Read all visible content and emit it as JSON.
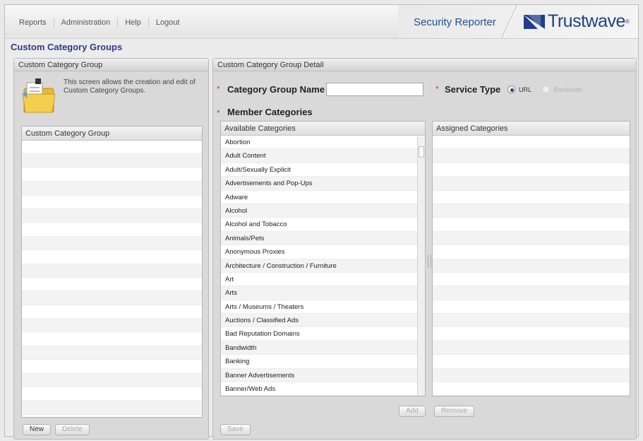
{
  "nav": {
    "items": [
      "Reports",
      "Administration",
      "Help",
      "Logout"
    ]
  },
  "brand": {
    "product": "Security Reporter",
    "logo": "Trustwave",
    "logo_reg": "®",
    "logo_icon": "trustwave-logo-icon"
  },
  "page_title": "Custom Category Groups",
  "left_panel": {
    "title": "Custom Category Group",
    "info_text": "This screen allows the creation and edit of Custom Category Groups.",
    "info_icon": "folder-icon",
    "grid_header": "Custom Category Group",
    "rows": [
      "",
      "",
      "",
      "",
      "",
      "",
      "",
      "",
      "",
      "",
      "",
      "",
      "",
      "",
      "",
      "",
      "",
      "",
      "",
      ""
    ],
    "new_label": "New",
    "delete_label": "Delete"
  },
  "right_panel": {
    "title": "Custom Category Group Detail",
    "required_mark": "*",
    "name_label": "Category Group Name",
    "name_value": "",
    "service_type_label": "Service Type",
    "service_options": [
      {
        "label": "URL",
        "selected": true,
        "enabled": true
      },
      {
        "label": "Bandwidth",
        "selected": false,
        "enabled": false
      }
    ],
    "member_label": "Member Categories",
    "available_header": "Available Categories",
    "available": [
      "Abortion",
      "Adult Content",
      "Adult/Sexually Explicit",
      "Advertisements and Pop-Ups",
      "Adware",
      "Alcohol",
      "Alcohol and Tobacco",
      "Animals/Pets",
      "Anonymous Proxies",
      "Architecture / Construction / Furniture",
      "Art",
      "Arts",
      "Arts / Museums / Theaters",
      "Auctions / Classified Ads",
      "Bad Reputation Domains",
      "Bandwidth",
      "Banking",
      "Banner Advertisements",
      "Banner/Web Ads"
    ],
    "assigned_header": "Assigned Categories",
    "assigned": [
      "",
      "",
      "",
      "",
      "",
      "",
      "",
      "",
      "",
      "",
      "",
      "",
      "",
      "",
      "",
      "",
      "",
      "",
      ""
    ],
    "add_label": "Add",
    "remove_label": "Remove",
    "save_label": "Save"
  },
  "colors": {
    "accent": "#2c3a8c",
    "brand": "#1f3f8a",
    "required": "#d0371f"
  }
}
